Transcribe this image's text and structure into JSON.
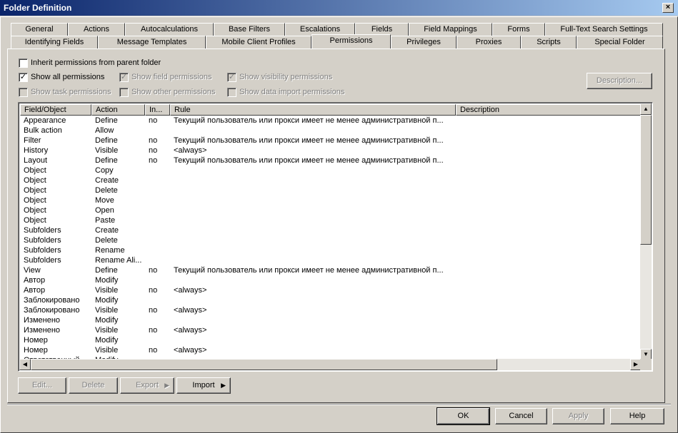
{
  "window": {
    "title": "Folder Definition",
    "close": "×"
  },
  "tabs_row1": [
    "General",
    "Actions",
    "Autocalculations",
    "Base Filters",
    "Escalations",
    "Fields",
    "Field Mappings",
    "Forms",
    "Full-Text Search Settings"
  ],
  "tabs_row2": [
    "Identifying Fields",
    "Message Templates",
    "Mobile Client Profiles",
    "Permissions",
    "Privileges",
    "Proxies",
    "Scripts",
    "Special Folder"
  ],
  "active_tab": "Permissions",
  "options": {
    "inherit": "Inherit permissions from parent folder",
    "show_all": "Show all permissions",
    "show_field": "Show field permissions",
    "show_visibility": "Show visibility permissions",
    "show_task": "Show task permissions",
    "show_other": "Show other permissions",
    "show_import": "Show data import permissions"
  },
  "description_button": "Description...",
  "columns": [
    "Field/Object",
    "Action",
    "In...",
    "Rule",
    "Description"
  ],
  "rows": [
    [
      "Appearance",
      "Define",
      "no",
      "Текущий пользователь или прокси имеет не менее административной п...",
      ""
    ],
    [
      "Bulk action",
      "Allow",
      "",
      "",
      ""
    ],
    [
      "Filter",
      "Define",
      "no",
      "Текущий пользователь или прокси имеет не менее административной п...",
      ""
    ],
    [
      "History",
      "Visible",
      "no",
      "<always>",
      ""
    ],
    [
      "Layout",
      "Define",
      "no",
      "Текущий пользователь или прокси имеет не менее административной п...",
      ""
    ],
    [
      "Object",
      "Copy",
      "",
      "",
      ""
    ],
    [
      "Object",
      "Create",
      "",
      "",
      ""
    ],
    [
      "Object",
      "Delete",
      "",
      "",
      ""
    ],
    [
      "Object",
      "Move",
      "",
      "",
      ""
    ],
    [
      "Object",
      "Open",
      "",
      "",
      ""
    ],
    [
      "Object",
      "Paste",
      "",
      "",
      ""
    ],
    [
      "Subfolders",
      "Create",
      "",
      "",
      ""
    ],
    [
      "Subfolders",
      "Delete",
      "",
      "",
      ""
    ],
    [
      "Subfolders",
      "Rename",
      "",
      "",
      ""
    ],
    [
      "Subfolders",
      "Rename Ali...",
      "",
      "",
      ""
    ],
    [
      "View",
      "Define",
      "no",
      "Текущий пользователь или прокси имеет не менее административной п...",
      ""
    ],
    [
      "Автор",
      "Modify",
      "",
      "",
      ""
    ],
    [
      "Автор",
      "Visible",
      "no",
      "<always>",
      ""
    ],
    [
      "Заблокировано",
      "Modify",
      "",
      "",
      ""
    ],
    [
      "Заблокировано",
      "Visible",
      "no",
      "<always>",
      ""
    ],
    [
      "Изменено",
      "Modify",
      "",
      "",
      ""
    ],
    [
      "Изменено",
      "Visible",
      "no",
      "<always>",
      ""
    ],
    [
      "Номер",
      "Modify",
      "",
      "",
      ""
    ],
    [
      "Номер",
      "Visible",
      "no",
      "<always>",
      ""
    ],
    [
      "Ответственный",
      "Modify",
      "",
      "",
      ""
    ]
  ],
  "action_buttons": {
    "edit": "Edit...",
    "delete": "Delete",
    "export": "Export",
    "import": "Import"
  },
  "dialog_buttons": {
    "ok": "OK",
    "cancel": "Cancel",
    "apply": "Apply",
    "help": "Help"
  }
}
